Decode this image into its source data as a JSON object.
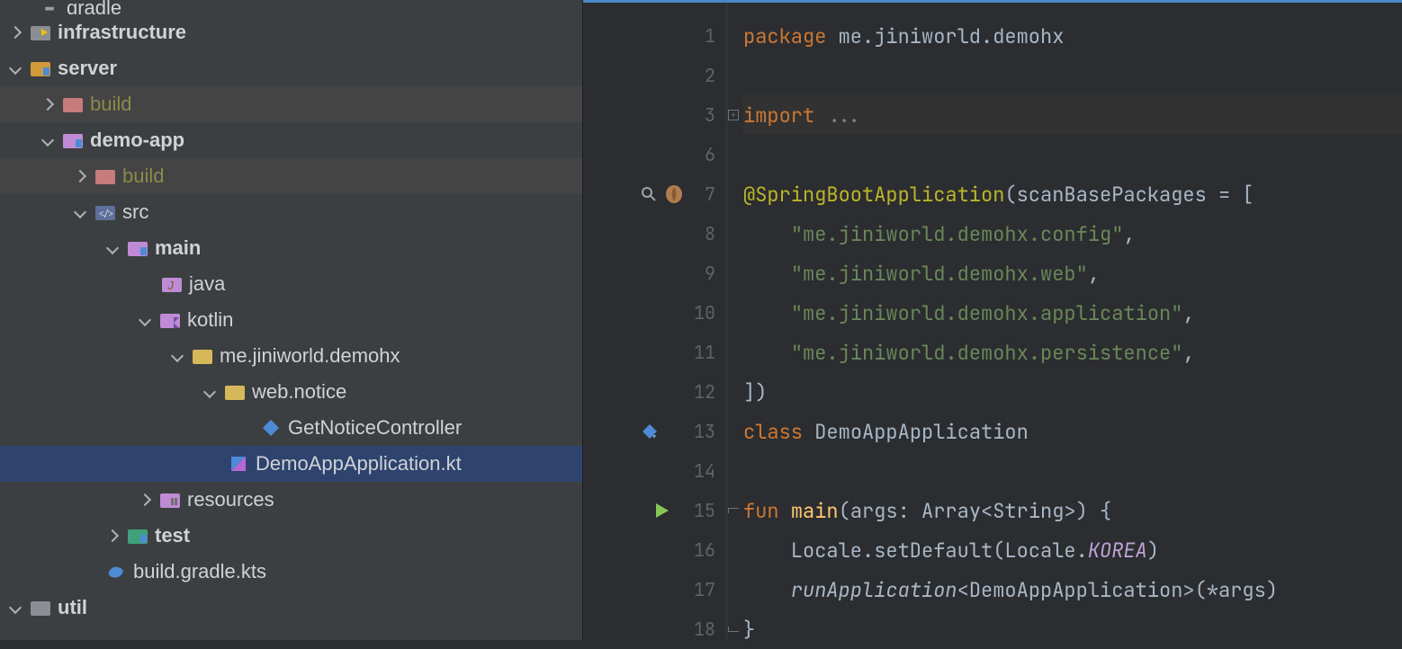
{
  "tree": {
    "gradle": "gradle",
    "infrastructure": "infrastructure",
    "server": "server",
    "build": "build",
    "demoapp": "demo-app",
    "src": "src",
    "main": "main",
    "java": "java",
    "kotlin": "kotlin",
    "pkg": "me.jiniworld.demohx",
    "webnotice": "web.notice",
    "controller": "GetNoticeController",
    "appkt": "DemoAppApplication.kt",
    "resources": "resources",
    "test": "test",
    "buildgradle": "build.gradle.kts",
    "util": "util"
  },
  "gutter": {
    "l1": "1",
    "l2": "2",
    "l3": "3",
    "l6": "6",
    "l7": "7",
    "l8": "8",
    "l9": "9",
    "l10": "10",
    "l11": "11",
    "l12": "12",
    "l13": "13",
    "l14": "14",
    "l15": "15",
    "l16": "16",
    "l17": "17",
    "l18": "18"
  },
  "code": {
    "l1_kw": "package",
    "l1_rest": " me.jiniworld.demohx",
    "l3_kw": "import",
    "l3_rest": " ...",
    "l7_ann": "@SpringBootApplication",
    "l7_rest": "(scanBasePackages = [",
    "l8_str": "\"me.jiniworld.demohx.config\"",
    "l9_str": "\"me.jiniworld.demohx.web\"",
    "l10_str": "\"me.jiniworld.demohx.application\"",
    "l11_str": "\"me.jiniworld.demohx.persistence\"",
    "l12": "])",
    "l13_kw": "class",
    "l13_rest": " DemoAppApplication",
    "l15_kw": "fun ",
    "l15_fn": "main",
    "l15_rest": "(args: Array<String>) {",
    "l16_a": "    Locale.setDefault(Locale.",
    "l16_b": "KOREA",
    "l16_c": ")",
    "l17_a": "    ",
    "l17_fn": "runApplication",
    "l17_b": "<DemoAppApplication>(*args)",
    "l18": "}",
    "comma": ",",
    "indent": "    "
  }
}
